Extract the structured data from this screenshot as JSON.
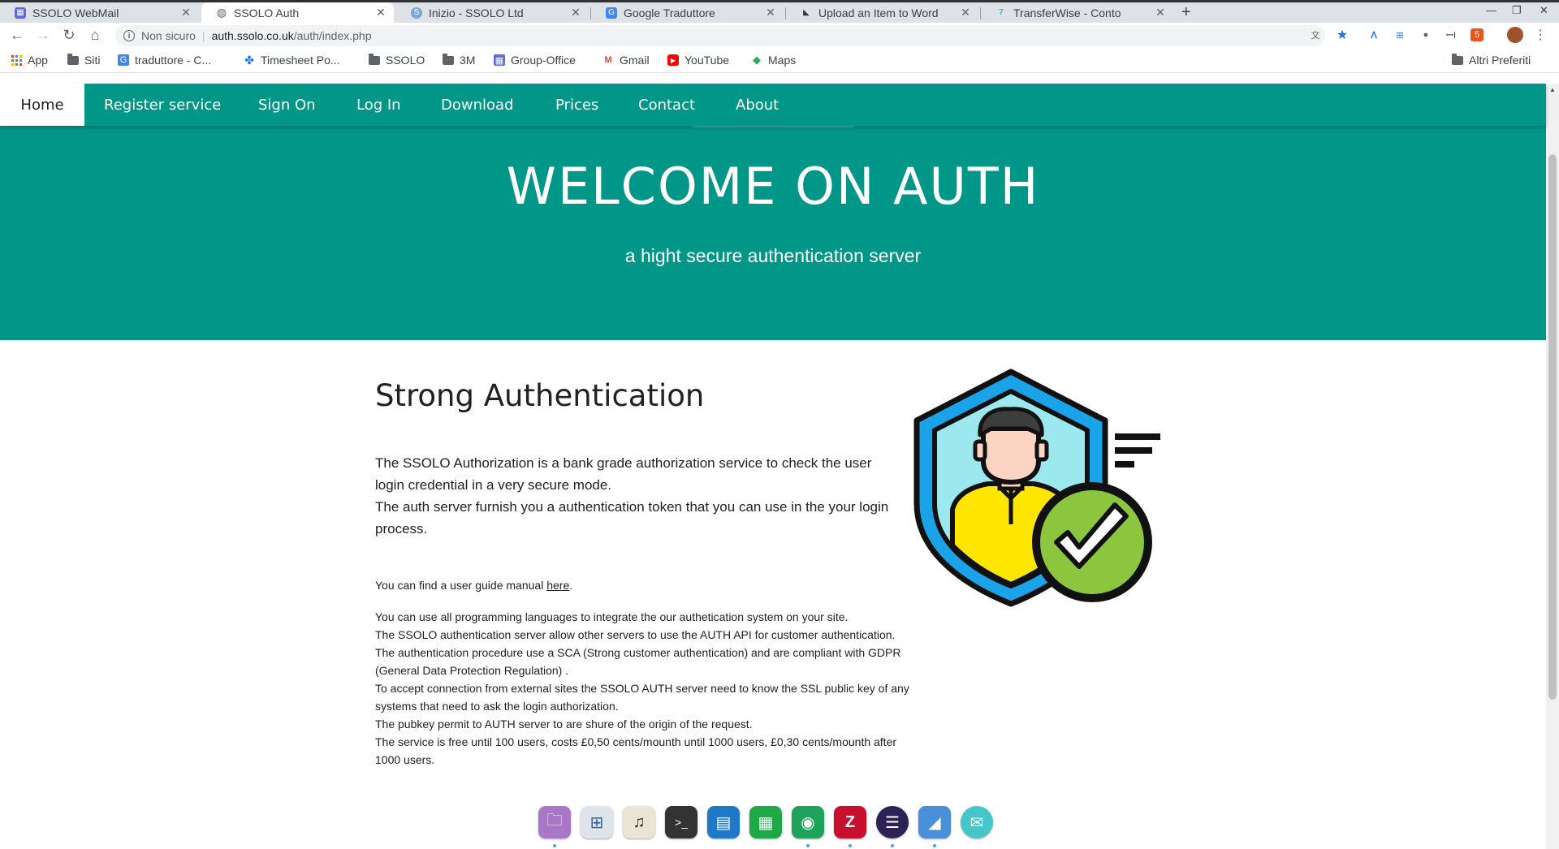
{
  "browser": {
    "tabs": [
      {
        "title": "SSOLO WebMail",
        "active": false,
        "favicon": "webmail-icon",
        "color": "#5f6ad9"
      },
      {
        "title": "SSOLO Auth",
        "active": true,
        "favicon": "globe-icon",
        "color": "#5f6368"
      },
      {
        "title": "Inizio - SSOLO Ltd",
        "active": false,
        "favicon": "site-icon",
        "color": "#7aa7d9"
      },
      {
        "title": "Google Traduttore",
        "active": false,
        "favicon": "translate-icon",
        "color": "#4285f4"
      },
      {
        "title": "Upload an Item to Word",
        "active": false,
        "favicon": "upload-icon",
        "color": "#333333"
      },
      {
        "title": "TransferWise - Conto",
        "active": false,
        "favicon": "transferwise-icon",
        "color": "#37b8e6"
      }
    ],
    "address": {
      "security": "Non sicuro",
      "host": "auth.ssolo.co.uk",
      "path": "/auth/index.php"
    },
    "bookmarks": [
      {
        "label": "App",
        "icon": "apps-icon"
      },
      {
        "label": "Siti",
        "icon": "folder-icon"
      },
      {
        "label": "traduttore - C...",
        "icon": "translate-icon"
      },
      {
        "label": "Timesheet Po...",
        "icon": "timesheet-icon"
      },
      {
        "label": "SSOLO",
        "icon": "folder-icon"
      },
      {
        "label": "3M",
        "icon": "folder-icon"
      },
      {
        "label": "Group-Office",
        "icon": "group-office-icon"
      },
      {
        "label": "Gmail",
        "icon": "gmail-icon"
      },
      {
        "label": "YouTube",
        "icon": "youtube-icon"
      },
      {
        "label": "Maps",
        "icon": "maps-icon"
      }
    ],
    "other_bookmarks": "Altri Preferiti"
  },
  "site": {
    "nav": [
      {
        "label": "Home",
        "active": true
      },
      {
        "label": "Register service",
        "active": false
      },
      {
        "label": "Sign On",
        "active": false
      },
      {
        "label": "Log In",
        "active": false
      },
      {
        "label": "Download",
        "active": false
      },
      {
        "label": "Prices",
        "active": false
      },
      {
        "label": "Contact",
        "active": false
      },
      {
        "label": "About",
        "active": false
      }
    ],
    "hero": {
      "title": "WELCOME ON AUTH",
      "subtitle": "a hight secure authentication server"
    },
    "section_title": "Strong Authentication",
    "intro": [
      "The SSOLO Authorization is a bank grade authorization service to check the user login credential in a very secure mode.",
      "The auth server furnish you a authentication token that you can use in the your login process."
    ],
    "guide": {
      "prefix": "You can find a user guide manual ",
      "link": "here",
      "suffix": "."
    },
    "details": [
      "You can use all programming languages to integrate the our authetication system on your site.",
      "The SSOLO authentication server allow other servers to use the AUTH API for customer authentication.",
      "The authentication procedure use a SCA (Strong customer authentication) and are compliant with GDPR (General Data Protection Regulation) .",
      "To accept connection from external sites the SSOLO AUTH server need to know the SSL public key of any systems that need to ask the login authorization.",
      "The pubkey permit to AUTH server to are shure of the origin of the request.",
      "The service is free until 100 users, costs £0,50 cents/mounth until 1000 users, £0,30 cents/mounth after 1000 users."
    ],
    "illustration": "secure-user-shield-icon",
    "colors": {
      "brand": "#009688",
      "shield_outer": "#1aa3e8",
      "shield_inner": "#9be8ee",
      "check": "#8cc63f",
      "shirt": "#ffe600"
    }
  },
  "dock": [
    {
      "name": "files-icon",
      "glyph": "🗀",
      "bg": "#a877c7"
    },
    {
      "name": "launcher-icon",
      "glyph": "⊞",
      "bg": "#dfe3ea"
    },
    {
      "name": "music-icon",
      "glyph": "♫",
      "bg": "#e9e4d4"
    },
    {
      "name": "terminal-icon",
      "glyph": ">_",
      "bg": "#333333"
    },
    {
      "name": "writer-icon",
      "glyph": "▤",
      "bg": "#1f78c8"
    },
    {
      "name": "calc-icon",
      "glyph": "▦",
      "bg": "#1ea848"
    },
    {
      "name": "chrome-icon",
      "glyph": "◉",
      "bg": "#1ea35b"
    },
    {
      "name": "filezilla-icon",
      "glyph": "Z",
      "bg": "#c8102e"
    },
    {
      "name": "eclipse-icon",
      "glyph": "☰",
      "bg": "#2c2255"
    },
    {
      "name": "rss-icon",
      "glyph": "◢",
      "bg": "#4a90d9"
    },
    {
      "name": "mail-icon",
      "glyph": "✉",
      "bg": "#45c7c9"
    }
  ]
}
